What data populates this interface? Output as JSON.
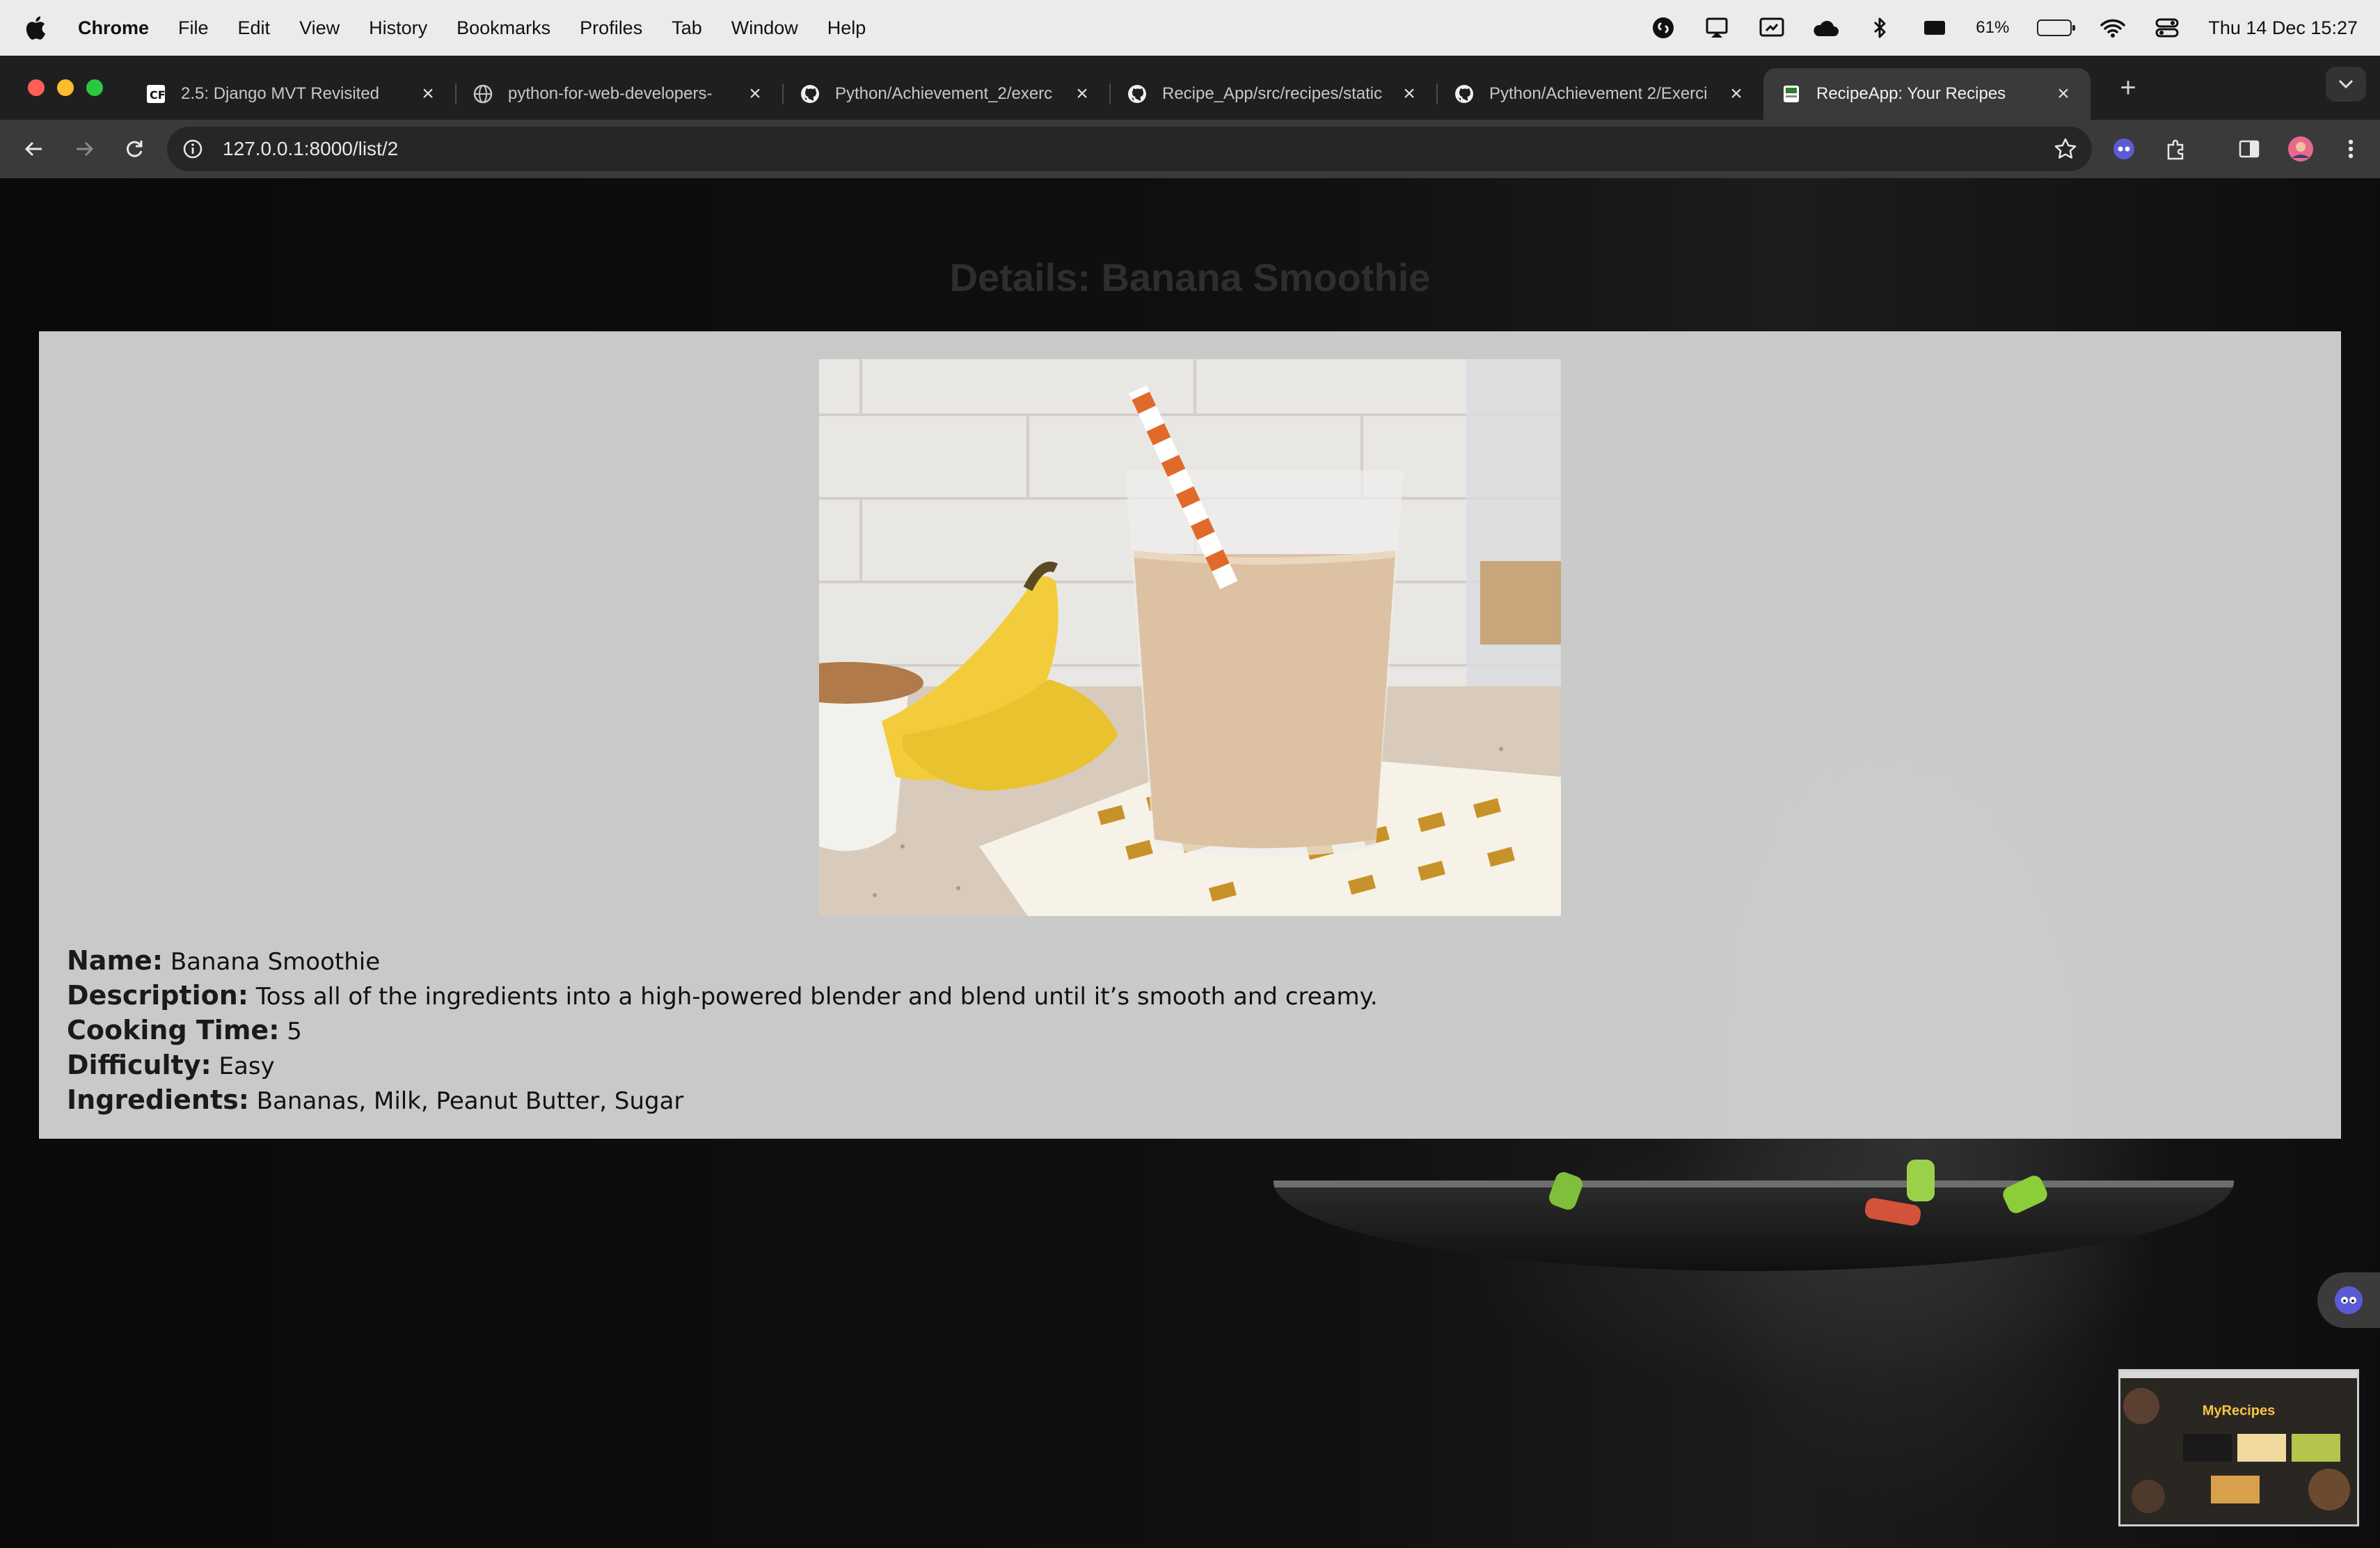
{
  "menubar": {
    "app_name": "Chrome",
    "items": [
      "File",
      "Edit",
      "View",
      "History",
      "Bookmarks",
      "Profiles",
      "Tab",
      "Window",
      "Help"
    ],
    "battery_percent": "61%",
    "battery_level": 0.61,
    "datetime": "Thu 14 Dec  15:27"
  },
  "tabs": [
    {
      "title": "2.5: Django MVT Revisited",
      "icon": "django-icon",
      "active": false
    },
    {
      "title": "python-for-web-developers-",
      "icon": "globe-icon",
      "active": false
    },
    {
      "title": "Python/Achievement_2/exerc",
      "icon": "github-icon",
      "active": false
    },
    {
      "title": "Recipe_App/src/recipes/static",
      "icon": "github-icon",
      "active": false
    },
    {
      "title": "Python/Achievement 2/Exerci",
      "icon": "github-icon",
      "active": false
    },
    {
      "title": "RecipeApp: Your Recipes",
      "icon": "recipe-app-icon",
      "active": true
    }
  ],
  "toolbar": {
    "url": "127.0.0.1:8000/list/2"
  },
  "page": {
    "title": "Details: Banana Smoothie",
    "image_alt": "Banana smoothie in a glass with a striped straw next to bananas",
    "fields": [
      {
        "label": "Name:",
        "value": "Banana Smoothie"
      },
      {
        "label": "Description:",
        "value": "Toss all of the ingredients into a high-powered blender and blend until it’s smooth and creamy."
      },
      {
        "label": "Cooking Time:",
        "value": "5"
      },
      {
        "label": "Difficulty:",
        "value": "Easy"
      },
      {
        "label": "Ingredients:",
        "value": "Bananas, Milk, Peanut Butter, Sugar"
      }
    ]
  },
  "thumbnail": {
    "brand": "MyRecipes"
  },
  "colors": {
    "menubar_bg": "#ebebeb",
    "tabstrip_bg": "#1f1f1f",
    "toolbar_bg": "#3a3a3a",
    "card_bg": "#d6d6d6",
    "title_text": "#2e2e2e"
  }
}
